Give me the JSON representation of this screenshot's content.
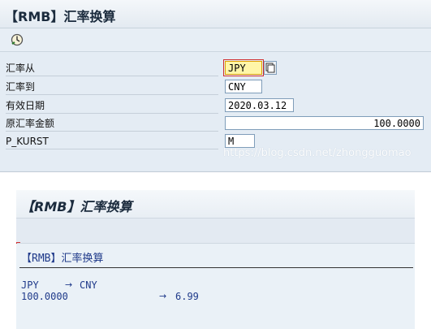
{
  "selection_screen": {
    "title": "【RMB】汇率换算",
    "execute_icon": "clock-execute-icon",
    "fields": [
      {
        "label": "汇率从",
        "value": "JPY",
        "active": true,
        "has_help": true
      },
      {
        "label": "汇率到",
        "value": "CNY"
      },
      {
        "label": "有效日期",
        "value": "2020.03.12"
      },
      {
        "label": "原汇率金额",
        "value": "100.0000"
      },
      {
        "label": "P_KURST",
        "value": "M"
      }
    ],
    "watermark": "https://blog.csdn.net/zhongguomao"
  },
  "result_screen": {
    "title": "【RMB】汇率换算",
    "list_title": "【RMB】汇率换算",
    "line1": {
      "from": "JPY",
      "arrow": "→",
      "to": "CNY"
    },
    "line2": {
      "amount": "100.0000",
      "arrow": "→",
      "result": "6.99"
    }
  },
  "colors": {
    "list_text": "#1f3a8a",
    "active_field": "#fff6a8"
  }
}
